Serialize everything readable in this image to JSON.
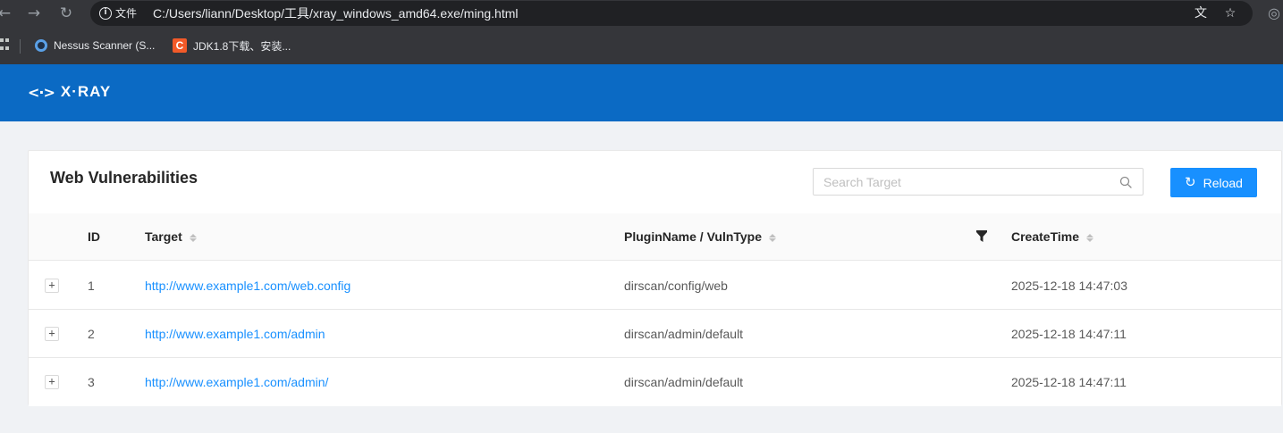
{
  "browser": {
    "info_label": "文件",
    "url": "C:/Users/liann/Desktop/工具/xray_windows_amd64.exe/ming.html",
    "icons": [
      "back-icon",
      "forward-icon",
      "reload-icon",
      "info-icon",
      "translate-icon",
      "star-icon",
      "profile-icon"
    ],
    "bookmarks": [
      {
        "label": "Nessus Scanner (S...",
        "icon": "nessus-favicon"
      },
      {
        "label": "JDK1.8下载、安装...",
        "icon": "csdn-favicon"
      }
    ]
  },
  "app": {
    "logo_mark": "<·>",
    "logo_text": "X·RAY",
    "brand_color": "#0b6ac4"
  },
  "panel": {
    "title": "Web Vulnerabilities",
    "search_placeholder": "Search Target",
    "reload_label": "Reload",
    "accent_color": "#1890ff"
  },
  "table": {
    "columns": {
      "id": "ID",
      "target": "Target",
      "plugin": "PluginName / VulnType",
      "create_time": "CreateTime"
    },
    "rows": [
      {
        "id": "1",
        "target": "http://www.example1.com/web.config",
        "plugin": "dirscan/config/web",
        "create_time": "2025-12-18 14:47:03"
      },
      {
        "id": "2",
        "target": "http://www.example1.com/admin",
        "plugin": "dirscan/admin/default",
        "create_time": "2025-12-18 14:47:11"
      },
      {
        "id": "3",
        "target": "http://www.example1.com/admin/",
        "plugin": "dirscan/admin/default",
        "create_time": "2025-12-18 14:47:11"
      }
    ]
  }
}
